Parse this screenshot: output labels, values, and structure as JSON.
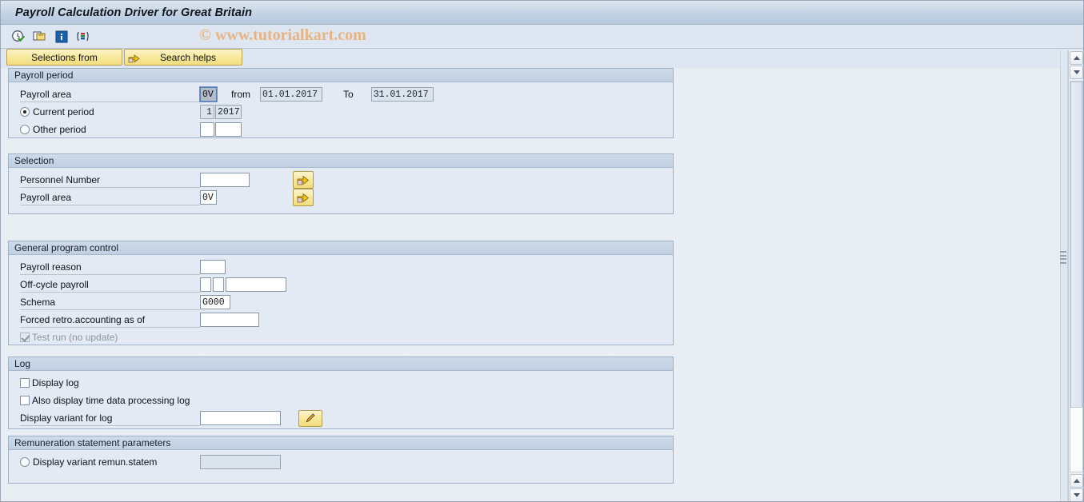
{
  "window": {
    "title": "Payroll Calculation Driver for Great Britain"
  },
  "watermark": "© www.tutorialkart.com",
  "toolbar": {
    "icons": [
      {
        "name": "execute-clock-icon",
        "title": "Execute"
      },
      {
        "name": "execute-background-icon",
        "title": "Execute in background"
      },
      {
        "name": "information-icon",
        "title": "Information"
      },
      {
        "name": "variant-bars-icon",
        "title": "Get variant"
      }
    ]
  },
  "buttons": {
    "selections_from": "Selections from",
    "search_helps": "Search helps"
  },
  "sections": {
    "payroll_period": {
      "header": "Payroll period",
      "payroll_area_label": "Payroll area",
      "payroll_area_value": "0V",
      "from_label": "from",
      "from_value": "01.01.2017",
      "to_label": "To",
      "to_value": "31.01.2017",
      "current_period_label": "Current period",
      "current_period_selected": true,
      "current_period_num": "1",
      "current_period_year": "2017",
      "other_period_label": "Other period",
      "other_period_selected": false,
      "other_period_num": "",
      "other_period_year": ""
    },
    "selection": {
      "header": "Selection",
      "personnel_number_label": "Personnel Number",
      "personnel_number_value": "",
      "payroll_area_label": "Payroll area",
      "payroll_area_value": "0V",
      "multi_select_icon": "multiple-selection-arrow-icon"
    },
    "general_program_control": {
      "header": "General program control",
      "payroll_reason_label": "Payroll reason",
      "payroll_reason_value": "",
      "off_cycle_label": "Off-cycle payroll",
      "off_cycle_v1": "",
      "off_cycle_v2": "",
      "off_cycle_v3": "",
      "schema_label": "Schema",
      "schema_value": "G000",
      "forced_retro_label": "Forced retro.accounting as of",
      "forced_retro_value": "",
      "test_run_label": "Test run (no update)",
      "test_run_checked": true,
      "test_run_disabled": true
    },
    "log": {
      "header": "Log",
      "display_log_label": "Display log",
      "display_log_checked": false,
      "time_data_label": "Also display time data processing log",
      "time_data_checked": false,
      "display_variant_label": "Display variant for log",
      "display_variant_value": "",
      "edit_icon": "pencil-edit-icon"
    },
    "remuneration": {
      "header": "Remuneration statement parameters",
      "display_variant_label": "Display variant remun.statem",
      "display_variant_selected": false,
      "display_variant_value": ""
    }
  },
  "scrollbar": {
    "up_arrow": "scroll-up-arrow-icon",
    "down_arrow": "scroll-down-arrow-icon",
    "resize_grip": "resize-grip-icon"
  },
  "colors": {
    "titlebar": "#c3d3e6",
    "button_yellow": "#f8e99c",
    "watermark": "#e8b383",
    "group_header": "#c7d5e6",
    "background": "#e9eef5"
  }
}
